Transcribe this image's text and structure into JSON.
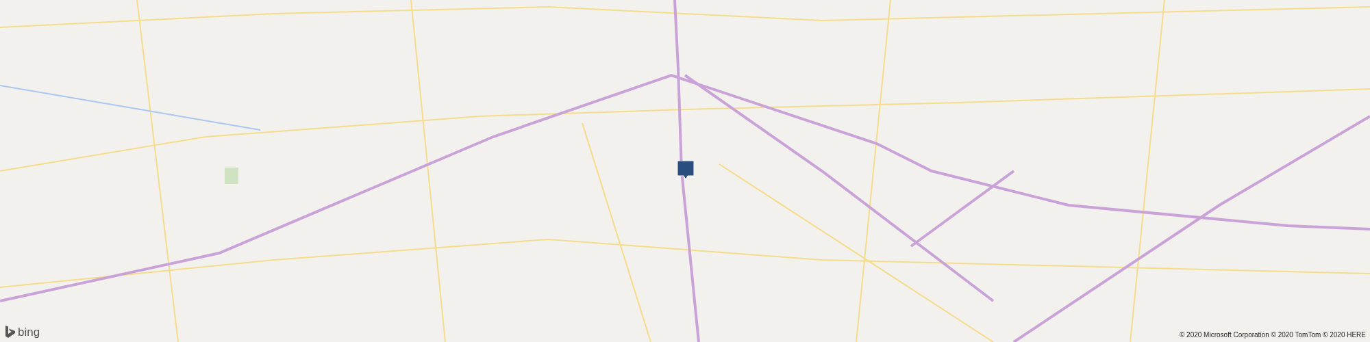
{
  "map": {
    "logo": {
      "text": "bing"
    },
    "copyright": "© 2020 Microsoft Corporation © 2020 TomTom © 2020 HERE"
  }
}
